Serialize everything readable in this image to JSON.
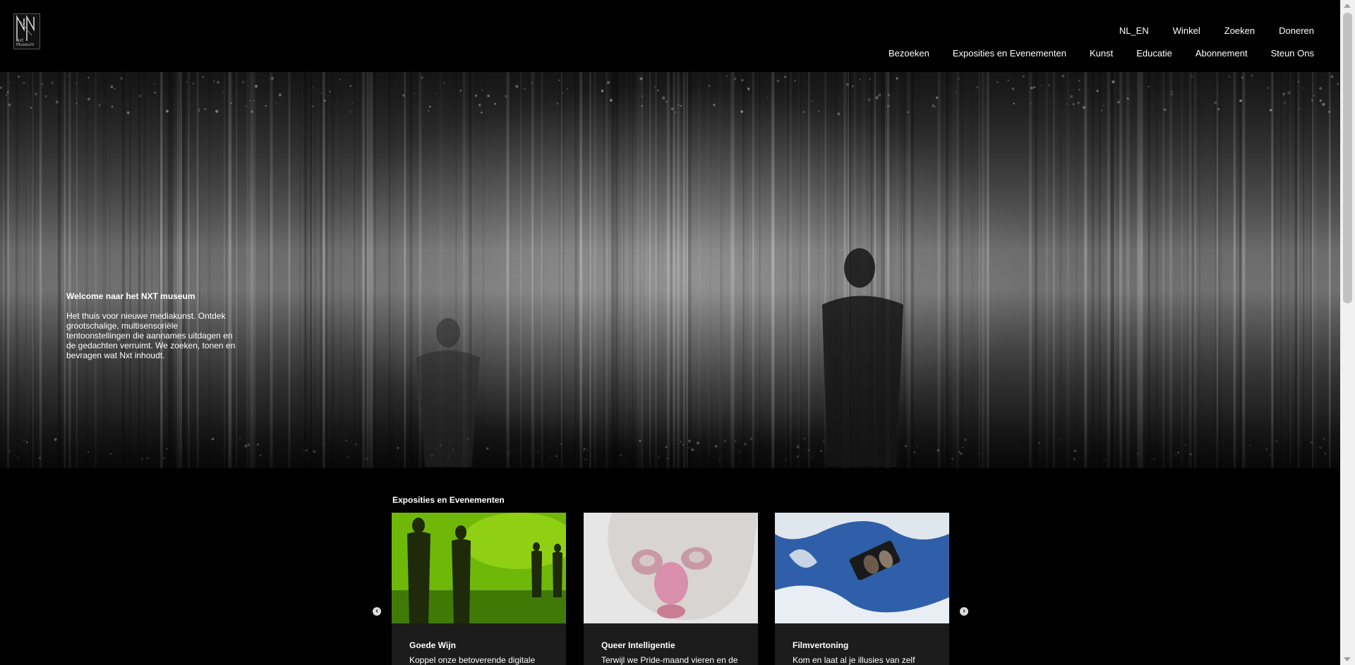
{
  "brand": {
    "logo_text": "Nxt Museum"
  },
  "top_nav": [
    "NL_EN",
    "Winkel",
    "Zoeken",
    "Doneren"
  ],
  "main_nav": [
    "Bezoeken",
    "Exposities en Evenementen",
    "Kunst",
    "Educatie",
    "Abonnement",
    "Steun Ons"
  ],
  "hero": {
    "title": "Welcome naar het NXT museum",
    "body": "Het thuis voor nieuwe mediakunst. Ontdek grootschalige, multisensoriële tentoonstellingen die aannames uitdagen en de gedachten verruimt. We zoeken, tonen en bevragen wat Nxt inhoudt."
  },
  "section": {
    "title": "Exposities en Evenementen",
    "cards": [
      {
        "title": "Goede Wijn",
        "desc": "Koppel onze betoverende digitale"
      },
      {
        "title": "Queer Intelligentie",
        "desc": "Terwijl we Pride-maand vieren en de"
      },
      {
        "title": "Filmvertoning",
        "desc": "Kom en laat al je illusies van zelf"
      }
    ],
    "prev_icon": "chevron-left-icon",
    "next_icon": "chevron-right-icon"
  }
}
